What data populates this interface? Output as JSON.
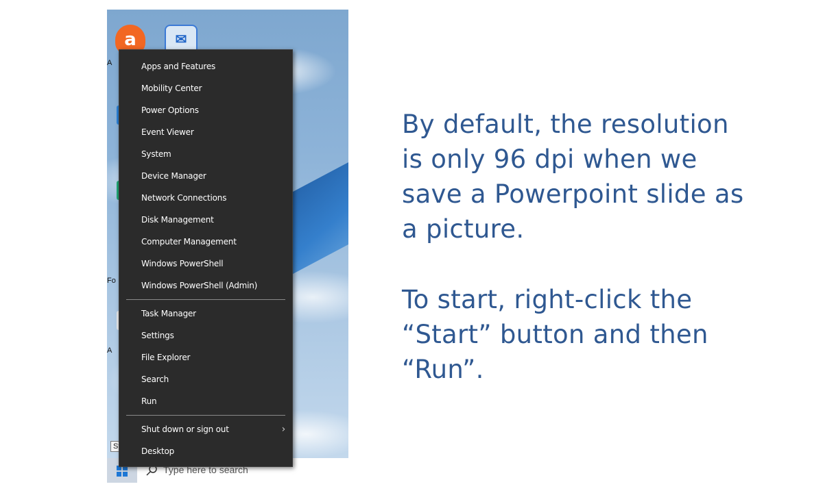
{
  "desktop": {
    "icons": [
      {
        "name": "avast",
        "glyph": "a"
      },
      {
        "name": "mail",
        "glyph": "✉"
      }
    ],
    "edge_labels": [
      "A",
      "A",
      "Fo",
      "A"
    ]
  },
  "context_menu": {
    "group1": [
      "Apps and Features",
      "Mobility Center",
      "Power Options",
      "Event Viewer",
      "System",
      "Device Manager",
      "Network Connections",
      "Disk Management",
      "Computer Management",
      "Windows PowerShell",
      "Windows PowerShell (Admin)"
    ],
    "group2": [
      "Task Manager",
      "Settings",
      "File Explorer",
      "Search",
      "Run"
    ],
    "group3": [
      "Shut down or sign out",
      "Desktop"
    ]
  },
  "taskbar": {
    "tooltip": "Start",
    "search_placeholder": "Type here to search"
  },
  "caption": {
    "paragraph1": "By default, the resolution\nis only 96 dpi when we\nsave a Powerpoint slide as\na picture.",
    "paragraph2": "To start, right-click the\n“Start” button and then\n“Run”."
  },
  "colors": {
    "caption_text": "#2f5891",
    "menu_bg": "#2b2b2b",
    "windows_blue": "#1e78d6"
  }
}
